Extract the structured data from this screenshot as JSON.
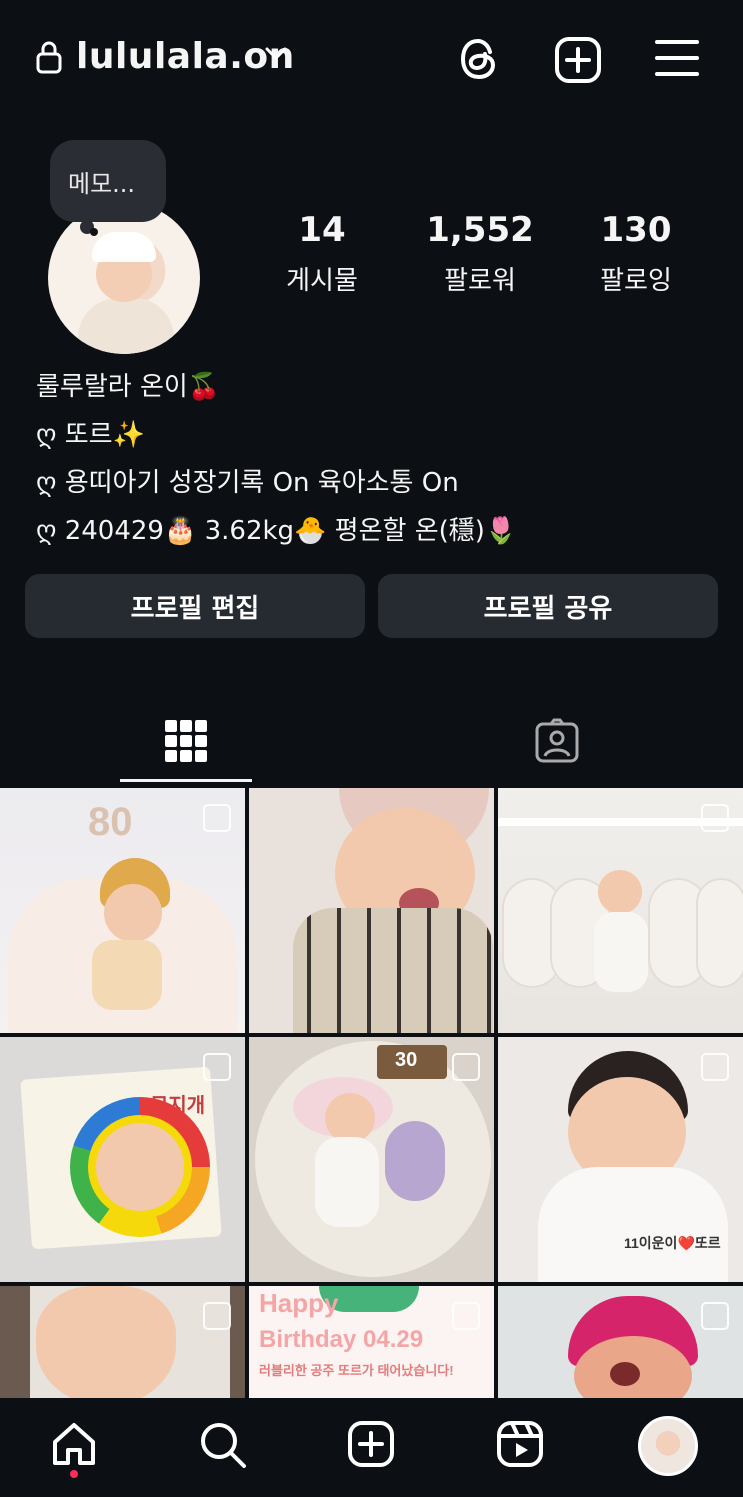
{
  "header": {
    "username": "lululala.on",
    "icons": [
      "lock-icon",
      "chevron-down-icon",
      "threads-icon",
      "add-post-icon",
      "menu-icon"
    ]
  },
  "note": {
    "text": "메모..."
  },
  "stats": [
    {
      "value": "14",
      "label": "게시물"
    },
    {
      "value": "1,552",
      "label": "팔로워"
    },
    {
      "value": "130",
      "label": "팔로잉"
    }
  ],
  "bio": {
    "name": "룰루랄라 온이🍒",
    "lines": [
      "ღ 또르✨",
      "ღ 용띠아기 성장기록 On 육아소통 On",
      "ღ 240429🎂 3.62kg🐣 평온할 온(穩)🌷"
    ]
  },
  "buttons": {
    "edit_profile": "프로필 편집",
    "share_profile": "프로필 공유"
  },
  "tiles": {
    "t1_number": "80",
    "t4_book_title": "무지개",
    "t5_sign": "30",
    "t6_caption": "11이운이❤️또르",
    "t8_line1": "Happy",
    "t8_line2": "Birthday 04.29",
    "t8_line3": "러블리한 공주 또르가 태어났습니다!"
  },
  "colors": {
    "background": "#0c0f14",
    "button": "#262a31",
    "accent_red": "#ff2d55"
  }
}
